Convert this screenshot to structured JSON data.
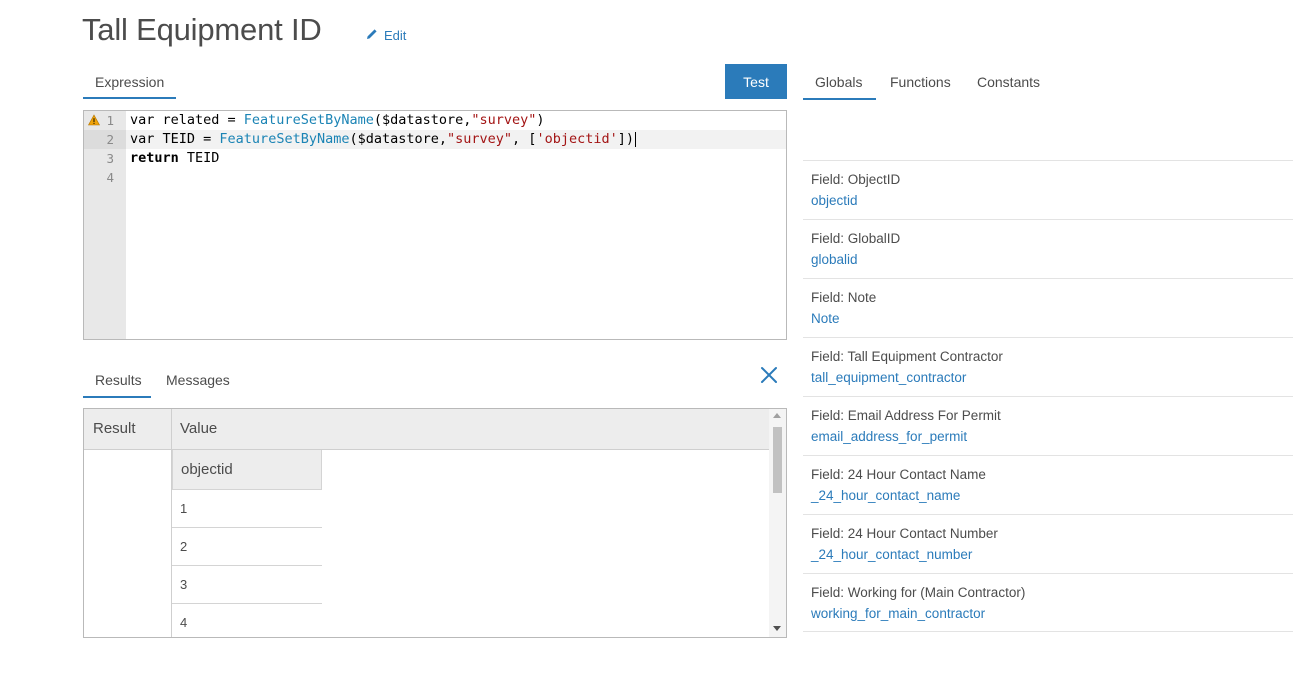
{
  "header": {
    "title": "Tall Equipment ID",
    "edit_label": "Edit"
  },
  "expression": {
    "tab_label": "Expression",
    "test_label": "Test",
    "lines": [
      {
        "num": "1",
        "warning": true
      },
      {
        "num": "2"
      },
      {
        "num": "3"
      },
      {
        "num": "4"
      }
    ],
    "code": {
      "l1_kw": "var",
      "l1_var": " related = ",
      "l1_fn": "FeatureSetByName",
      "l1_args": "($datastore,",
      "l1_str": "\"survey\"",
      "l1_close": ")",
      "l2_kw": "var",
      "l2_var": " TEID = ",
      "l2_fn": "FeatureSetByName",
      "l2_args": "($datastore,",
      "l2_str": "\"survey\"",
      "l2_mid": ", [",
      "l2_str2": "'objectid'",
      "l2_close": "])",
      "l3_kw": "return",
      "l3_rest": " TEID"
    }
  },
  "results": {
    "tabs": {
      "results": "Results",
      "messages": "Messages"
    },
    "headers": {
      "result": "Result",
      "value": "Value"
    },
    "inner_header": "objectid",
    "rows": [
      "1",
      "2",
      "3",
      "4"
    ]
  },
  "right_panel": {
    "tabs": {
      "globals": "Globals",
      "functions": "Functions",
      "constants": "Constants"
    },
    "globals": [
      {
        "label": "Field: ObjectID",
        "name": "objectid"
      },
      {
        "label": "Field: GlobalID",
        "name": "globalid"
      },
      {
        "label": "Field: Note",
        "name": "Note"
      },
      {
        "label": "Field: Tall Equipment Contractor",
        "name": "tall_equipment_contractor"
      },
      {
        "label": "Field: Email Address For Permit",
        "name": "email_address_for_permit"
      },
      {
        "label": "Field: 24 Hour Contact Name",
        "name": "_24_hour_contact_name"
      },
      {
        "label": "Field: 24 Hour Contact Number",
        "name": "_24_hour_contact_number"
      },
      {
        "label": "Field: Working for (Main Contractor)",
        "name": "working_for_main_contractor"
      }
    ]
  },
  "colors": {
    "accent": "#2b7bba",
    "warning": "#f0a30a",
    "string": "#a31515",
    "function": "#1b84b5"
  },
  "icons": {
    "edit": "pencil-icon",
    "close": "close-icon",
    "warning": "warning-icon"
  }
}
